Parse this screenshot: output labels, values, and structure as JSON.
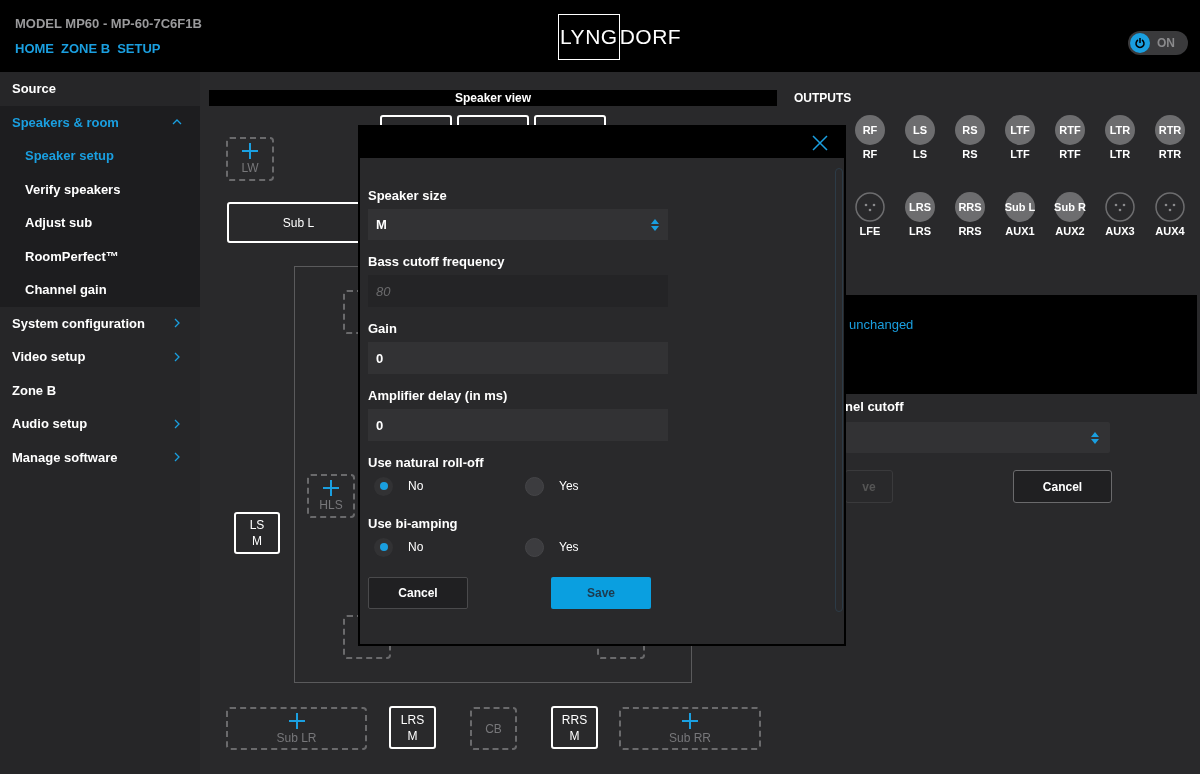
{
  "header": {
    "model": "MODEL MP60 - MP-60-7C6F1B",
    "nav": [
      "HOME",
      "ZONE B",
      "SETUP"
    ],
    "logo": {
      "boxed": "LYNG",
      "rest": "DORF"
    },
    "power": {
      "label": "ON",
      "on": true
    }
  },
  "sidebar": {
    "items": [
      {
        "label": "Source",
        "kind": "link"
      },
      {
        "label": "Speakers & room",
        "kind": "group",
        "expanded": true,
        "children": [
          {
            "label": "Speaker setup",
            "selected": true
          },
          {
            "label": "Verify speakers",
            "selected": false
          },
          {
            "label": "Adjust sub",
            "selected": false
          },
          {
            "label": "RoomPerfect™",
            "selected": false
          },
          {
            "label": "Channel gain",
            "selected": false
          }
        ]
      },
      {
        "label": "System configuration",
        "kind": "group",
        "expanded": false
      },
      {
        "label": "Video setup",
        "kind": "group",
        "expanded": false
      },
      {
        "label": "Zone B",
        "kind": "link"
      },
      {
        "label": "Audio setup",
        "kind": "group",
        "expanded": false
      },
      {
        "label": "Manage software",
        "kind": "group",
        "expanded": false
      }
    ]
  },
  "speaker_view": {
    "title": "Speaker view",
    "nodes": [
      {
        "kind": "speaker"
      },
      {
        "kind": "speaker"
      },
      {
        "kind": "speaker"
      },
      {
        "kind": "add",
        "label": "LW"
      },
      {
        "kind": "speaker",
        "label": "Sub L"
      },
      {
        "kind": "placeholder"
      },
      {
        "kind": "add",
        "label": "HLS"
      },
      {
        "kind": "speaker",
        "label": "LS",
        "size": "M"
      },
      {
        "kind": "placeholder"
      },
      {
        "kind": "placeholder"
      },
      {
        "kind": "add",
        "label": "Sub LR"
      },
      {
        "kind": "speaker",
        "label": "LRS",
        "size": "M"
      },
      {
        "kind": "placeholder",
        "label": "CB"
      },
      {
        "kind": "speaker",
        "label": "RRS",
        "size": "M"
      },
      {
        "kind": "add",
        "label": "Sub RR"
      }
    ]
  },
  "outputs": {
    "title": "OUTPUTS",
    "rows": [
      [
        {
          "kind": "assigned",
          "badge": "RF",
          "label": "RF"
        },
        {
          "kind": "assigned",
          "badge": "LS",
          "label": "LS"
        },
        {
          "kind": "assigned",
          "badge": "RS",
          "label": "RS"
        },
        {
          "kind": "assigned",
          "badge": "LTF",
          "label": "LTF"
        },
        {
          "kind": "assigned",
          "badge": "RTF",
          "label": "RTF"
        },
        {
          "kind": "assigned",
          "badge": "LTR",
          "label": "LTR"
        },
        {
          "kind": "assigned",
          "badge": "RTR",
          "label": "RTR"
        }
      ],
      [
        {
          "kind": "connector",
          "label": "LFE"
        },
        {
          "kind": "assigned",
          "badge": "LRS",
          "label": "LRS"
        },
        {
          "kind": "assigned",
          "badge": "RRS",
          "label": "RRS"
        },
        {
          "kind": "assigned",
          "badge": "Sub L",
          "label": "AUX1"
        },
        {
          "kind": "assigned",
          "badge": "Sub R",
          "label": "AUX2"
        },
        {
          "kind": "connector",
          "label": "AUX3"
        },
        {
          "kind": "connector",
          "label": "AUX4"
        }
      ]
    ]
  },
  "side_panel": {
    "message": "unchanged",
    "cutoff_label": "nel cutoff",
    "buttons": [
      {
        "label": "ve",
        "disabled": true
      },
      {
        "label": "Cancel",
        "disabled": false
      }
    ]
  },
  "dialog": {
    "fields": [
      {
        "kind": "select",
        "label": "Speaker size",
        "value": "M"
      },
      {
        "kind": "input",
        "label": "Bass cutoff frequency",
        "placeholder": "80",
        "disabled": true
      },
      {
        "kind": "input",
        "label": "Gain",
        "value": "0",
        "disabled": false
      },
      {
        "kind": "input",
        "label": "Amplifier delay (in ms)",
        "value": "0",
        "disabled": false
      },
      {
        "kind": "radio",
        "label": "Use natural roll-off",
        "options": [
          {
            "label": "No",
            "selected": true
          },
          {
            "label": "Yes",
            "selected": false
          }
        ]
      },
      {
        "kind": "radio",
        "label": "Use bi-amping",
        "options": [
          {
            "label": "No",
            "selected": true
          },
          {
            "label": "Yes",
            "selected": false
          }
        ]
      }
    ],
    "buttons": [
      {
        "label": "Cancel",
        "kind": "secondary"
      },
      {
        "label": "Save",
        "kind": "primary"
      }
    ]
  }
}
